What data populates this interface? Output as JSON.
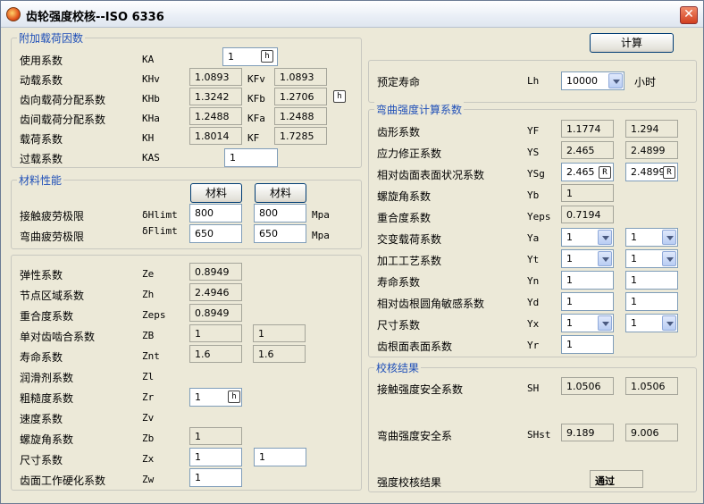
{
  "window": {
    "title": "齿轮强度校核--ISO 6336",
    "close": "✕"
  },
  "load": {
    "title": "附加载荷因数",
    "use": {
      "label": "使用系数",
      "sym": "KA",
      "value": "1",
      "btn": "h"
    },
    "dyn": {
      "label": "动载系数",
      "sym": "KHv",
      "value": "1.0893",
      "sym2": "KFv",
      "value2": "1.0893"
    },
    "face": {
      "label": "齿向载荷分配系数",
      "sym": "KHb",
      "value": "1.3242",
      "sym2": "KFb",
      "value2": "1.2706",
      "btn": "h"
    },
    "trans": {
      "label": "齿间载荷分配系数",
      "sym": "KHa",
      "value": "1.2488",
      "sym2": "KFa",
      "value2": "1.2488"
    },
    "total": {
      "label": "载荷系数",
      "sym": "KH",
      "value": "1.8014",
      "sym2": "KF",
      "value2": "1.7285"
    },
    "overload": {
      "label": "过载系数",
      "sym": "KAS",
      "value": "1"
    }
  },
  "material": {
    "title": "材料性能",
    "btn1": "材料",
    "btn2": "材料",
    "contact": {
      "label": "接触疲劳极限",
      "sym": "δHlimt",
      "v1": "800",
      "v2": "800",
      "unit": "Mpa"
    },
    "bending": {
      "label": "弯曲疲劳极限",
      "sym": "δFlimt",
      "v1": "650",
      "v2": "650",
      "unit": "Mpa"
    }
  },
  "contact": {
    "elastic": {
      "label": "弹性系数",
      "sym": "Ze",
      "value": "0.8949"
    },
    "zone": {
      "label": "节点区域系数",
      "sym": "Zh",
      "value": "2.4946"
    },
    "contact_ratio": {
      "label": "重合度系数",
      "sym": "Zeps",
      "value": "0.8949"
    },
    "single": {
      "label": "单对齿啮合系数",
      "sym": "ZB",
      "v1": "1",
      "v2": "1"
    },
    "life": {
      "label": "寿命系数",
      "sym": "Znt",
      "v1": "1.6",
      "v2": "1.6"
    },
    "lub": {
      "label": "润滑剂系数",
      "sym": "Zl"
    },
    "rough": {
      "label": "粗糙度系数",
      "sym": "Zr",
      "value": "1",
      "btn": "h"
    },
    "speed": {
      "label": "速度系数",
      "sym": "Zv"
    },
    "helix": {
      "label": "螺旋角系数",
      "sym": "Zb",
      "value": "1"
    },
    "size": {
      "label": "尺寸系数",
      "sym": "Zx",
      "v1": "1",
      "v2": "1"
    },
    "work": {
      "label": "齿面工作硬化系数",
      "sym": "Zw",
      "value": "1"
    }
  },
  "calc_btn": "计算",
  "life": {
    "label": "预定寿命",
    "sym": "Lh",
    "value": "10000",
    "unit": "小时"
  },
  "bend": {
    "title": "弯曲强度计算系数",
    "form": {
      "label": "齿形系数",
      "sym": "YF",
      "v1": "1.1774",
      "v2": "1.294"
    },
    "stress": {
      "label": "应力修正系数",
      "sym": "YS",
      "v1": "2.465",
      "v2": "2.4899"
    },
    "rel": {
      "label": "相对齿面表面状况系数",
      "sym": "YSg",
      "v1": "2.465",
      "v2": "2.4899",
      "btn": "R"
    },
    "helix": {
      "label": "螺旋角系数",
      "sym": "Yb",
      "value": "1"
    },
    "ratio": {
      "label": "重合度系数",
      "sym": "Yeps",
      "value": "0.7194"
    },
    "alt": {
      "label": "交变载荷系数",
      "sym": "Ya",
      "v1": "1",
      "v2": "1"
    },
    "proc": {
      "label": "加工工艺系数",
      "sym": "Yt",
      "v1": "1",
      "v2": "1"
    },
    "life": {
      "label": "寿命系数",
      "sym": "Yn",
      "v1": "1",
      "v2": "1"
    },
    "notch": {
      "label": "相对齿根圆角敏感系数",
      "sym": "Yd",
      "v1": "1",
      "v2": "1"
    },
    "size": {
      "label": "尺寸系数",
      "sym": "Yx",
      "v1": "1",
      "v2": "1"
    },
    "root": {
      "label": "齿根面表面系数",
      "sym": "Yr",
      "value": "1"
    }
  },
  "result": {
    "title": "校核结果",
    "contact": {
      "label": "接触强度安全系数",
      "sym": "SH",
      "v1": "1.0506",
      "v2": "1.0506"
    },
    "bending": {
      "label": "弯曲强度安全系",
      "sym": "SHst",
      "v1": "9.189",
      "v2": "9.006"
    },
    "final": {
      "label": "强度校核结果",
      "value": "通过"
    }
  }
}
